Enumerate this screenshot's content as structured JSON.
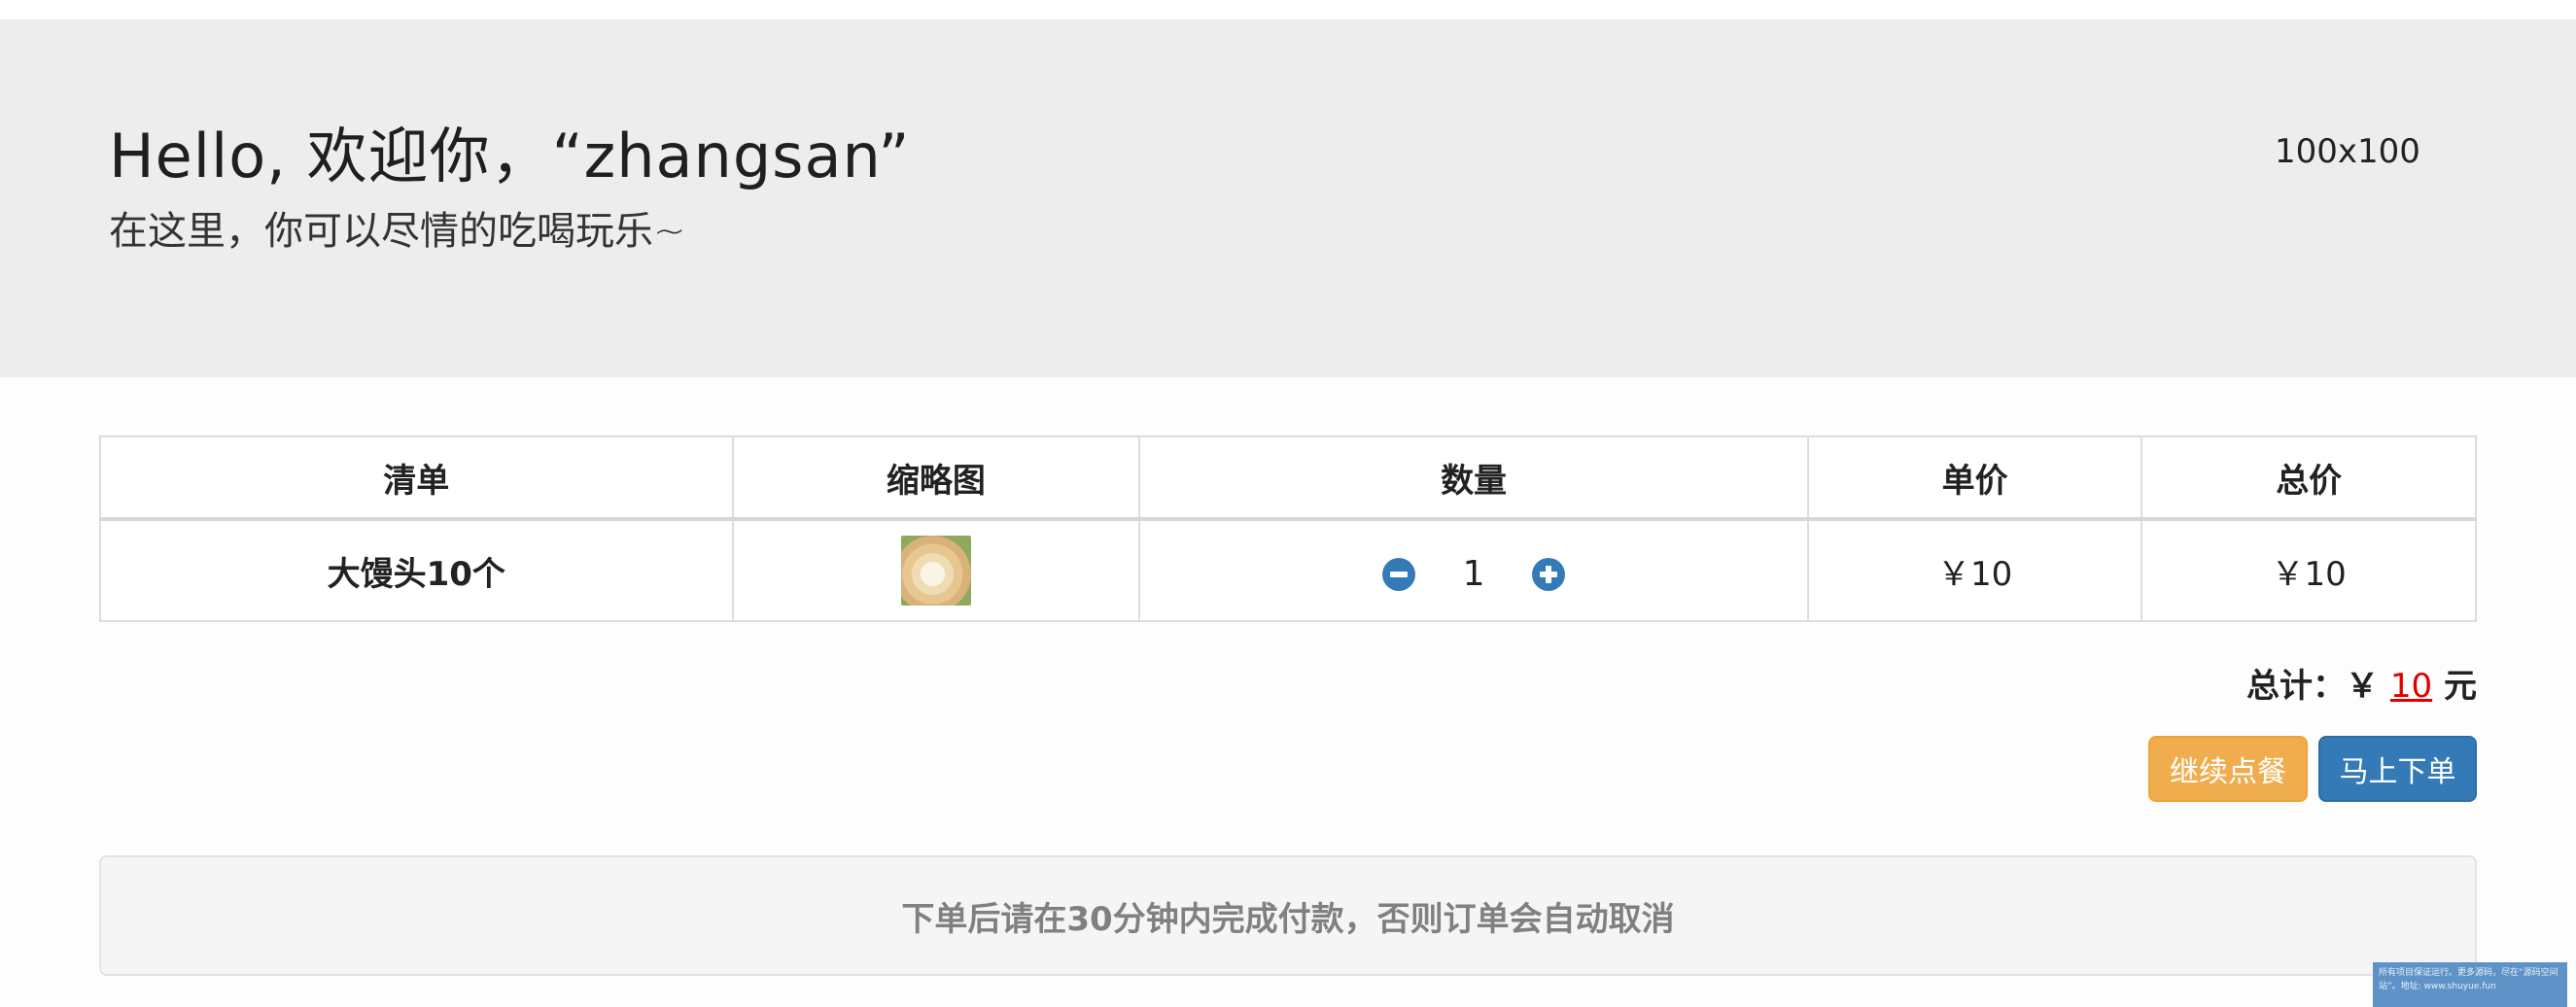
{
  "header": {
    "greeting": "Hello, 欢迎你，“zhangsan”",
    "subtitle": "在这里，你可以尽情的吃喝玩乐~",
    "avatar_placeholder": "100x100"
  },
  "table": {
    "columns": [
      "清单",
      "缩略图",
      "数量",
      "单价",
      "总价"
    ],
    "rows": [
      {
        "name": "大馒头10个",
        "thumbnail": "steamed-bun-image",
        "quantity": "1",
        "unit_price": "￥10",
        "total_price": "￥10"
      }
    ]
  },
  "summary": {
    "label": "总计：￥",
    "amount": "10",
    "unit": "元"
  },
  "buttons": {
    "continue": "继续点餐",
    "order": "马上下单"
  },
  "notice": "下单后请在30分钟内完成付款，否则订单会自动取消",
  "watermark": "所有项目保证运行。更多源码，尽在“源码空间站”。地址: www.shuyue.fun",
  "colors": {
    "primary": "#337ab7",
    "warning": "#f0ad4e",
    "amount_red": "#e00000",
    "jumbotron_bg": "#ededed"
  },
  "icons": {
    "decrease": "minus-circle-icon",
    "increase": "plus-circle-icon"
  }
}
